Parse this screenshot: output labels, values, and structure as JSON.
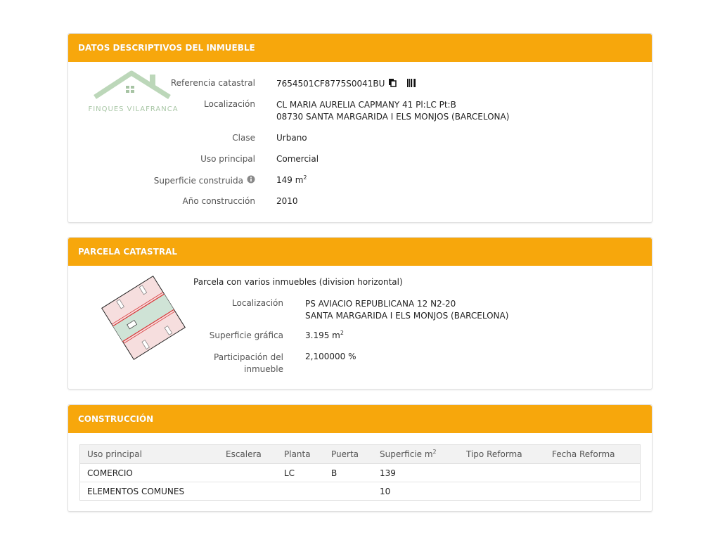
{
  "panel1": {
    "title": "DATOS DESCRIPTIVOS DEL INMUEBLE",
    "logo_text": "FINQUES VILAFRANCA",
    "fields": {
      "ref_label": "Referencia catastral",
      "ref_value": "7654501CF8775S0041BU",
      "loc_label": "Localización",
      "loc_line1": "CL MARIA AURELIA CAPMANY 41 Pl:LC Pt:B",
      "loc_line2": "08730 SANTA MARGARIDA I ELS MONJOS (BARCELONA)",
      "clase_label": "Clase",
      "clase_value": "Urbano",
      "uso_label": "Uso principal",
      "uso_value": "Comercial",
      "sup_label": "Superficie construida",
      "sup_value": "149 m",
      "sup_exp": "2",
      "anio_label": "Año construcción",
      "anio_value": "2010"
    },
    "icons": {
      "copy": "copy-icon",
      "barcode": "barcode-icon",
      "info": "info-icon"
    }
  },
  "panel2": {
    "title": "PARCELA CATASTRAL",
    "subtitle": "Parcela con varios inmuebles (division horizontal)",
    "loc_label": "Localización",
    "loc_line1": "PS AVIACIO REPUBLICANA 12 N2-20",
    "loc_line2": "SANTA MARGARIDA I ELS MONJOS (BARCELONA)",
    "supg_label": "Superficie gráfica",
    "supg_value": "3.195 m",
    "supg_exp": "2",
    "part_label_1": "Participación del",
    "part_label_2": "inmueble",
    "part_value": "2,100000 %"
  },
  "panel3": {
    "title": "CONSTRUCCIÓN",
    "headers": {
      "uso": "Uso principal",
      "escalera": "Escalera",
      "planta": "Planta",
      "puerta": "Puerta",
      "superficie": "Superficie m",
      "superficie_exp": "2",
      "tipo": "Tipo Reforma",
      "fecha": "Fecha Reforma"
    },
    "rows": [
      {
        "uso": "COMERCIO",
        "escalera": "",
        "planta": "LC",
        "puerta": "B",
        "superficie": "139",
        "tipo": "",
        "fecha": ""
      },
      {
        "uso": "ELEMENTOS COMUNES",
        "escalera": "",
        "planta": "",
        "puerta": "",
        "superficie": "10",
        "tipo": "",
        "fecha": ""
      }
    ]
  },
  "colors": {
    "accent": "#f7a70c",
    "parcel_fill": "#f6dede",
    "parcel_center": "#cfe3d6",
    "parcel_line": "#d9383a"
  }
}
